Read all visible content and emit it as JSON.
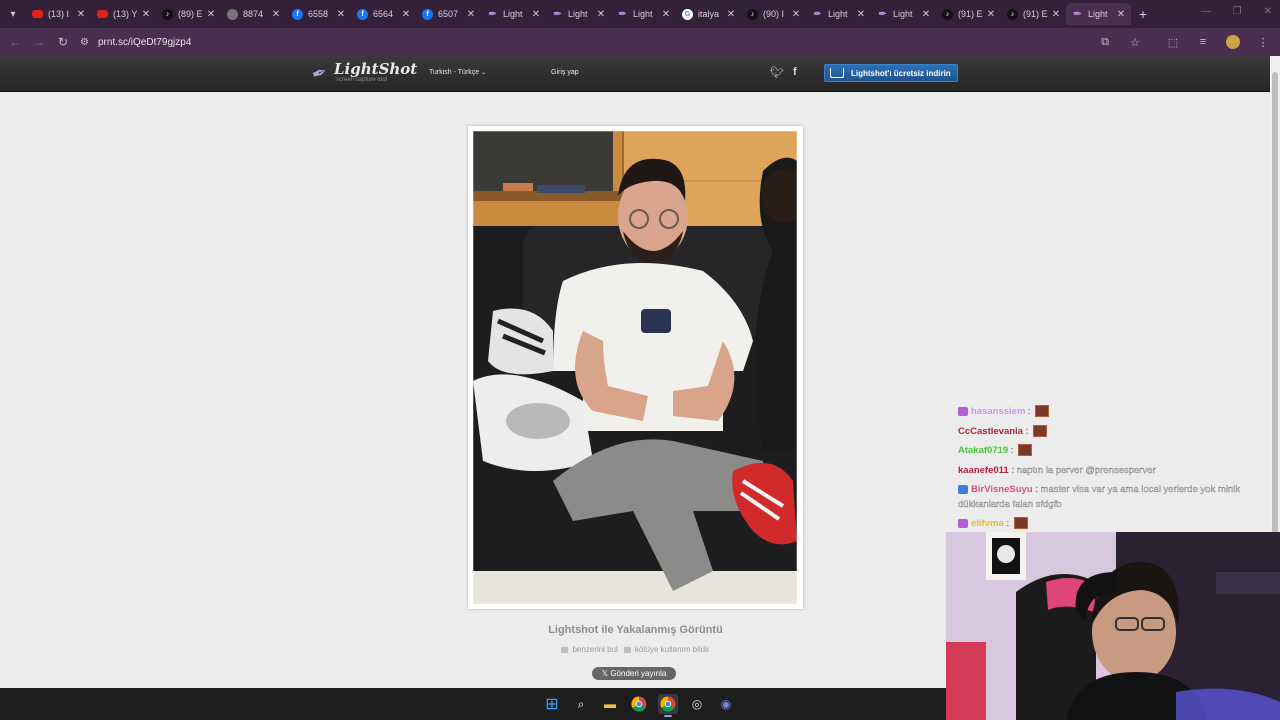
{
  "browser": {
    "tabs": [
      {
        "title": "(13) I",
        "icon": "youtube-icon"
      },
      {
        "title": "(13) Y",
        "icon": "youtube-icon"
      },
      {
        "title": "(89) E",
        "icon": "tiktok-icon"
      },
      {
        "title": "8874",
        "icon": "globe-icon"
      },
      {
        "title": "6558",
        "icon": "facebook-icon"
      },
      {
        "title": "6564",
        "icon": "facebook-icon"
      },
      {
        "title": "6507",
        "icon": "facebook-icon"
      },
      {
        "title": "Light",
        "icon": "lightshot-icon"
      },
      {
        "title": "Light",
        "icon": "lightshot-icon"
      },
      {
        "title": "Light",
        "icon": "lightshot-icon"
      },
      {
        "title": "italya",
        "icon": "google-icon"
      },
      {
        "title": "(90) I",
        "icon": "tiktok-icon"
      },
      {
        "title": "Light",
        "icon": "lightshot-icon"
      },
      {
        "title": "Light",
        "icon": "lightshot-icon"
      },
      {
        "title": "(91) E",
        "icon": "tiktok-icon"
      },
      {
        "title": "(91) E",
        "icon": "tiktok-icon"
      },
      {
        "title": "Light",
        "icon": "lightshot-icon",
        "active": true
      }
    ],
    "url": "prnt.sc/iQeDt79gjzp4"
  },
  "lightshot": {
    "logo_name": "LightShot",
    "logo_sub": "screen capture tool",
    "language": "Turkish - Türkçe",
    "login": "Giriş yap",
    "download": "Lightshot'ı ücretsiz indirin",
    "caption": "Lightshot ile Yakalanmış Görüntü",
    "find_similar": "benzerini bul",
    "report_abuse": "kötüye kullanım bildir",
    "post_button": "Gönderi yayınla"
  },
  "chat": [
    {
      "user": "hasanssiem",
      "color": "#c79be6",
      "message": "",
      "badge": "#b25fd9",
      "emote": true
    },
    {
      "user": "CcCastlevania",
      "color": "#b8203a",
      "message": "",
      "badge": "",
      "emote": true
    },
    {
      "user": "Atakaf0719",
      "color": "#47c73a",
      "message": "",
      "badge": "",
      "emote": true
    },
    {
      "user": "kaanefe011",
      "color": "#b8203a",
      "message": "naptın la perver @prensesperver",
      "badge": "",
      "emote": false
    },
    {
      "user": "BirVisneSuyu",
      "color": "#e0507a",
      "message": "master visa var ya ama local yerlerde yok minik dükkanlarda falan sfdgfb",
      "badge": "#3d7fd9",
      "emote": false
    },
    {
      "user": "elifvma",
      "color": "#e8b93a",
      "message": "",
      "badge": "#b25fd9",
      "emote": true
    }
  ]
}
